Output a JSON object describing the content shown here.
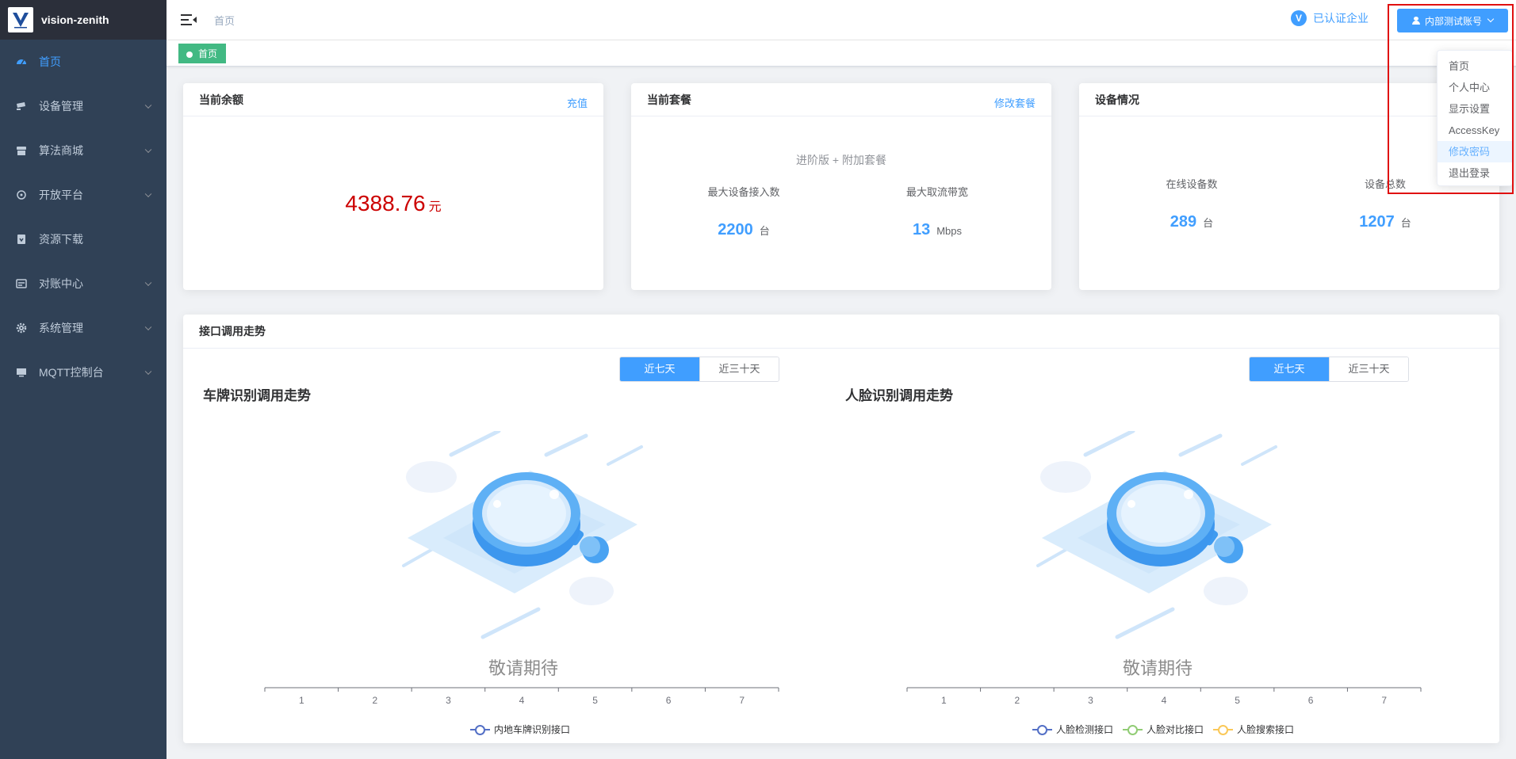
{
  "app": {
    "name": "vision-zenith"
  },
  "sidebar": {
    "items": [
      {
        "label": "首页",
        "icon": "dashboard-icon",
        "active": true
      },
      {
        "label": "设备管理",
        "icon": "camera-icon"
      },
      {
        "label": "算法商城",
        "icon": "shop-icon"
      },
      {
        "label": "开放平台",
        "icon": "open-platform-icon"
      },
      {
        "label": "资源下载",
        "icon": "download-icon"
      },
      {
        "label": "对账中心",
        "icon": "billing-icon"
      },
      {
        "label": "系统管理",
        "icon": "gear-icon"
      },
      {
        "label": "MQTT控制台",
        "icon": "monitor-icon"
      }
    ]
  },
  "header": {
    "breadcrumb": "首页",
    "verified_label": "已认证企业",
    "verified_icon_letter": "V",
    "account_label": "内部测试账号"
  },
  "tags": {
    "active": "首页"
  },
  "dropdown": {
    "items": [
      "首页",
      "个人中心",
      "显示设置",
      "AccessKey",
      "修改密码",
      "退出登录"
    ],
    "hovered": "修改密码"
  },
  "balance_card": {
    "title": "当前余额",
    "action": "充值",
    "amount": "4388.76",
    "unit": "元"
  },
  "package_card": {
    "title": "当前套餐",
    "action": "修改套餐",
    "package_name": "进阶版 + 附加套餐",
    "max_devices_label": "最大设备接入数",
    "max_devices_value": "2200",
    "max_devices_unit": "台",
    "max_bandwidth_label": "最大取流带宽",
    "max_bandwidth_value": "13",
    "max_bandwidth_unit": "Mbps"
  },
  "device_card": {
    "title": "设备情况",
    "online_label": "在线设备数",
    "online_value": "289",
    "online_unit": "台",
    "total_label": "设备总数",
    "total_value": "1207",
    "total_unit": "台"
  },
  "trend": {
    "title": "接口调用走势",
    "range_options": [
      "近七天",
      "近三十天"
    ],
    "selected_range": "近七天",
    "placeholder_text": "敬请期待"
  },
  "chart_data": [
    {
      "type": "line",
      "title": "车牌识别调用走势",
      "categories": [
        "1",
        "2",
        "3",
        "4",
        "5",
        "6",
        "7"
      ],
      "series": [
        {
          "name": "内地车牌识别接口",
          "values": [],
          "color": "#5470c6"
        }
      ]
    },
    {
      "type": "line",
      "title": "人脸识别调用走势",
      "categories": [
        "1",
        "2",
        "3",
        "4",
        "5",
        "6",
        "7"
      ],
      "series": [
        {
          "name": "人脸检测接口",
          "values": [],
          "color": "#5470c6"
        },
        {
          "name": "人脸对比接口",
          "values": [],
          "color": "#91cc75"
        },
        {
          "name": "人脸搜索接口",
          "values": [],
          "color": "#fac858"
        }
      ]
    }
  ],
  "colors": {
    "accent": "#409eff",
    "sidebar_bg": "#304156",
    "tag_green": "#42b983",
    "balance_red": "#cc0000",
    "highlight_box": "#e01010"
  }
}
